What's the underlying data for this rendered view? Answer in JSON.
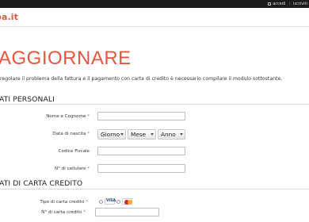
{
  "topbar": {
    "login": "accedi",
    "register": "iscriviti"
  },
  "header": {
    "logo": "ba.it"
  },
  "page": {
    "title": "AGGIORNARE",
    "intro": "regolare il problema della fattura e il pagamento con carta di credito è necessario compilare il modulo sottostante."
  },
  "personal": {
    "section_title": "ATI PERSONALI",
    "name_label": "Nome e Cognome",
    "dob_label": "Data di nascita",
    "day_select": "Giorno",
    "month_select": "Mese",
    "year_select": "Anno",
    "tax_label": "Codice Fiscale",
    "phone_label": "N° di cellulare"
  },
  "card": {
    "section_title": "ATI DI CARTA CREDITO",
    "type_label": "Tipo di carta credito",
    "number_label": "N° di carta credito",
    "visa_text": "VISA"
  },
  "required_mark": "*",
  "colors": {
    "accent": "#e8553f",
    "topbar": "#1c1c1c"
  },
  "icons": [
    "lock-icon",
    "visa-icon",
    "mastercard-icon"
  ]
}
